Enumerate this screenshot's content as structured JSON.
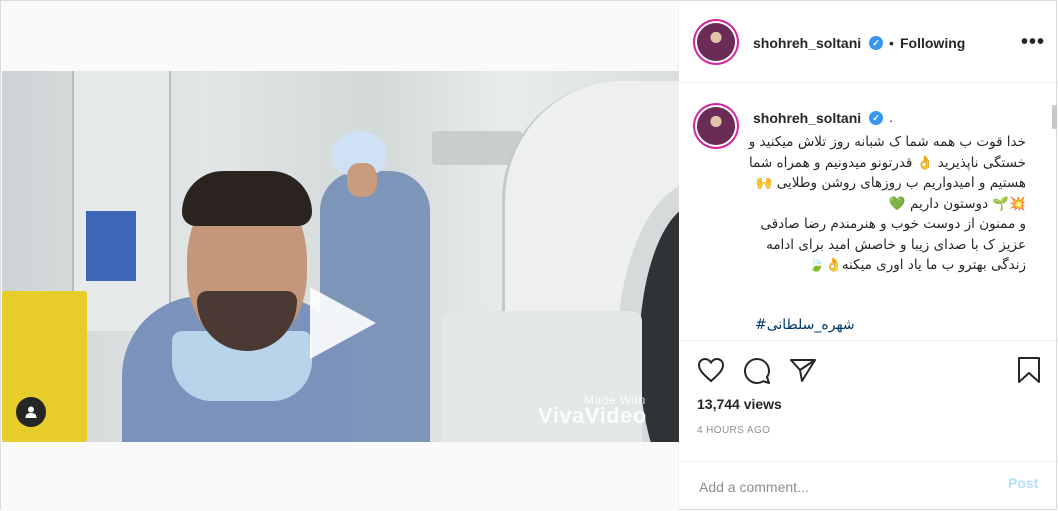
{
  "post": {
    "username": "shohreh_soltani",
    "follow_dot": "•",
    "follow_status": "Following",
    "more_label": "•••",
    "caption_dot": ".",
    "caption": "خدا قوت ب همه شما ک شبانه روز تلاش میکنید و خستگی ناپذیرید 👌 قدرتونو میدونیم و همراه شما هستیم و امیدواریم ب روزهای روشن وطلایی 🙌💥🌱 دوستون داریم 💚\nو ممنون از دوست خوب و هنرمندم رضا صادقی عزیز ک با صدای زیبا و خاصش امید برای ادامه زندگی بهترو ب ما یاد اوری میکنه👌🍃",
    "hashtag": "#شهره_سلطانی",
    "views": "13,744 views",
    "time_ago": "4 HOURS AGO"
  },
  "video": {
    "watermark_top": "Made With",
    "watermark_main": "VivaVideo"
  },
  "comment_box": {
    "placeholder": "Add a comment...",
    "post_label": "Post"
  },
  "colors": {
    "verified": "#3897f0",
    "post_disabled": "#b2dffc",
    "hashtag": "#00376b",
    "story_ring": "#d6249f"
  },
  "icons": [
    "play-icon",
    "user-tag-icon",
    "verified-icon",
    "more-icon",
    "heart-icon",
    "comment-icon",
    "share-icon",
    "bookmark-icon"
  ]
}
